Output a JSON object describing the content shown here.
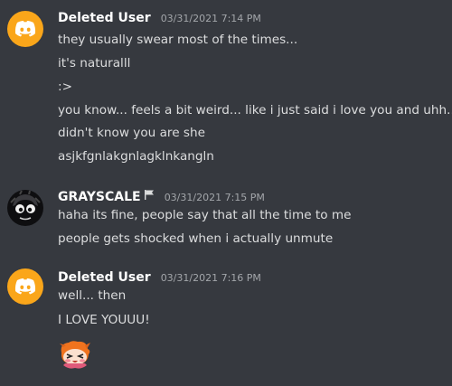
{
  "messages": [
    {
      "username": "Deleted User",
      "timestamp": "03/31/2021 7:14 PM",
      "avatar": "discord-logo-icon",
      "lines": [
        "they usually swear most of the times...",
        "it's naturalll",
        ":>",
        "you know... feels a bit weird... like i just said i love you and uhh...",
        "didn't know you are she",
        "asjkfgnlakgnlagklnkangln"
      ]
    },
    {
      "username": "GRAYSCALE",
      "timestamp": "03/31/2021 7:15 PM",
      "avatar": "grayscale-avatar",
      "badge": "flag-icon",
      "lines": [
        "haha its fine, people say that all the time to me",
        "people gets shocked when i actually unmute"
      ]
    },
    {
      "username": "Deleted User",
      "timestamp": "03/31/2021 7:16 PM",
      "avatar": "discord-logo-icon",
      "lines": [
        "well... then",
        "I LOVE YOUUU!"
      ],
      "emoji": "blushing-character-emoji"
    }
  ],
  "colors": {
    "background": "#36393f",
    "username": "#ffffff",
    "text": "#dcddde",
    "timestamp": "#a3a6aa",
    "deleted_avatar": "#faa61a"
  }
}
